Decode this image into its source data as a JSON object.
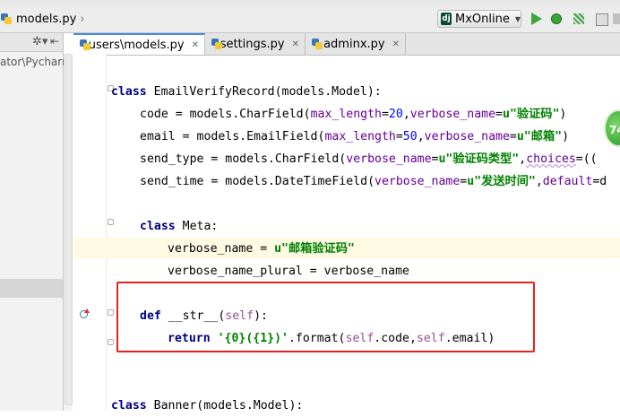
{
  "breadcrumb": {
    "file": "models.py"
  },
  "run_config": {
    "icon_text": "dj",
    "name": "MxOnline"
  },
  "left_panel": {
    "path_fragment": "ator\\Pycharr"
  },
  "tabs": [
    {
      "label": "users\\models.py",
      "active": true
    },
    {
      "label": "settings.py",
      "active": false
    },
    {
      "label": "adminx.py",
      "active": false
    }
  ],
  "code": {
    "l1": {
      "kw": "class",
      "rest": " EmailVerifyRecord(models.Model):"
    },
    "l2": {
      "a": "code = models.CharField(",
      "p1": "max_length",
      "eq1": "=",
      "n1": "20",
      "c1": ",",
      "p2": "verbose_name",
      "eq2": "=",
      "s1": "u\"验证码\"",
      "end": ")"
    },
    "l3": {
      "a": "email = models.EmailField(",
      "p1": "max_length",
      "eq1": "=",
      "n1": "50",
      "c1": ",",
      "p2": "verbose_name",
      "eq2": "=",
      "s1": "u\"邮箱\"",
      "end": ")"
    },
    "l4": {
      "a": "send_type = models.CharField(",
      "p1": "verbose_name",
      "eq1": "=",
      "s1": "u\"验证码类型\"",
      "c1": ",",
      "p2": "choices",
      "end": "=(("
    },
    "l5": {
      "a": "send_time = models.DateTimeField(",
      "p1": "verbose_name",
      "eq1": "=",
      "s1": "u\"发送时间\"",
      "c1": ",",
      "p2": "default",
      "end": "=d"
    },
    "l6": {
      "kw": "class",
      "rest": " Meta:"
    },
    "l7": {
      "a": "verbose_name = ",
      "s1": "u\"邮箱验证码\""
    },
    "l8": {
      "a": "verbose_name_plural = verbose_name"
    },
    "l9": {
      "kw": "def",
      "mid": " __str__(",
      "self": "self",
      "end": "):"
    },
    "l10": {
      "kw": "return",
      "s1": " '{0}({1})'",
      "mid": ".format(",
      "self1": "self",
      "a1": ".code,",
      "self2": "self",
      "end": ".email)"
    },
    "l11": {
      "kw": "class",
      "rest": " Banner(models.Model):"
    }
  },
  "badge": {
    "value": "74"
  },
  "colors": {
    "keyword": "#000080",
    "string": "#008000",
    "number": "#0000ff",
    "param": "#660099",
    "self": "#94558d",
    "highlight_box": "#e8201c",
    "active_tab_accent": "#4a89dc"
  },
  "icons": [
    "python-file-icon",
    "django-icon",
    "run-icon",
    "debug-icon",
    "coverage-icon",
    "stop-icon",
    "gear-icon",
    "pin-icon",
    "bookmark-icon"
  ]
}
